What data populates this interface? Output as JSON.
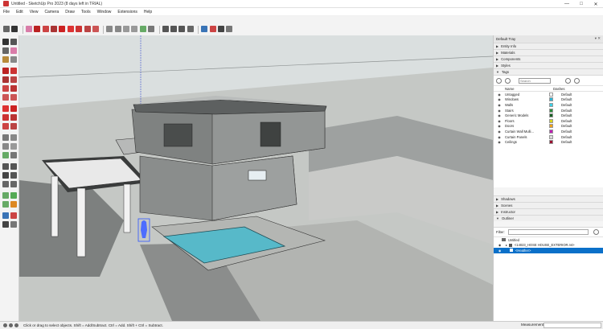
{
  "window": {
    "title": "Untitled - SketchUp Pro 2023 (8 days left in TRIAL)",
    "minimize_glyph": "—",
    "maximize_glyph": "□",
    "close_glyph": "✕"
  },
  "menu": [
    "File",
    "Edit",
    "View",
    "Camera",
    "Draw",
    "Tools",
    "Window",
    "Extensions",
    "Help"
  ],
  "tray": {
    "title": "Default Tray",
    "controls": "▾ ✕",
    "panels_top": [
      "Entity Info",
      "Materials",
      "Components",
      "Styles",
      "Tags"
    ],
    "panels_bottom": [
      "Shadows",
      "Scenes",
      "Instructor",
      "Outliner"
    ]
  },
  "tags": {
    "search_placeholder": "Search",
    "col_name": "Name",
    "col_dashes": "Dashes",
    "rows": [
      {
        "name": "Untagged",
        "color": "#ffffff",
        "dashes": "Default"
      },
      {
        "name": "Windows",
        "color": "#2cb5d6",
        "dashes": "Default"
      },
      {
        "name": "Walls",
        "color": "#3ad0e6",
        "dashes": "Default"
      },
      {
        "name": "Stairs",
        "color": "#2a8a3a",
        "dashes": "Default"
      },
      {
        "name": "Generic Models",
        "color": "#165f22",
        "dashes": "Default"
      },
      {
        "name": "Floors",
        "color": "#d9d51a",
        "dashes": "Default"
      },
      {
        "name": "Doors",
        "color": "#f0a21a",
        "dashes": "Default"
      },
      {
        "name": "Curtain Wall Mulli...",
        "color": "#c01bb5",
        "dashes": "Default"
      },
      {
        "name": "Curtain Panels",
        "color": "#d9d9d9",
        "dashes": "Default"
      },
      {
        "name": "Ceilings",
        "color": "#9a1030",
        "dashes": "Default"
      }
    ]
  },
  "outliner": {
    "filter_label": "Filter:",
    "items": [
      {
        "label": "Untitled",
        "selected": false
      },
      {
        "label": "<14023_HOSE HOUSE_EXTERIOR.rvt>",
        "selected": false
      },
      {
        "label": "<Heather>",
        "selected": true
      }
    ]
  },
  "status": {
    "hint": "Click or drag to select objects. Shift = Add/Subtract. Ctrl = Add. Shift + Ctrl = Subtract.",
    "measurements_label": "Measurements"
  },
  "colors": {
    "selection": "#0b70c9",
    "pool_water": "#57b9c9",
    "sky": "#dadfdf",
    "ground": "#c2c5c2"
  }
}
